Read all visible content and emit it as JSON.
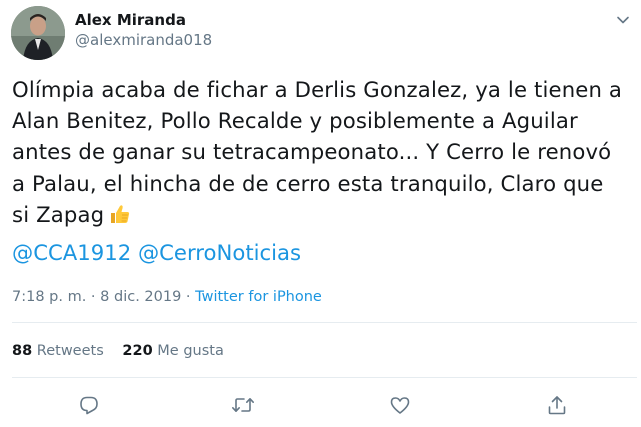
{
  "author": {
    "display_name": "Alex Miranda",
    "handle": "@alexmiranda018"
  },
  "tweet": {
    "lines": [
      "Olímpia acaba de fichar a Derlis Gonzalez, ya le tienen a",
      "Alan Benitez, Pollo Recalde y posiblemente a Aguilar",
      "antes de ganar su tetracampeonato... Y Cerro le renovó",
      "a Palau, el hincha de de cerro esta tranquilo, Claro que",
      "si Zapag"
    ],
    "emoji": "thumbs-up-icon",
    "mentions": [
      "@CCA1912",
      "@CerroNoticias"
    ]
  },
  "meta": {
    "time": "7:18 p. m.",
    "separator": " · ",
    "date": "8 dic. 2019",
    "source": "Twitter for iPhone"
  },
  "stats": {
    "retweets_count": "88",
    "retweets_label": "Retweets",
    "likes_count": "220",
    "likes_label": "Me gusta"
  },
  "actions": [
    "reply-icon",
    "retweet-icon",
    "like-icon",
    "share-icon"
  ],
  "colors": {
    "link": "#1b95e0",
    "muted": "#657786",
    "text": "#14171a",
    "divider": "#e6ecf0"
  }
}
